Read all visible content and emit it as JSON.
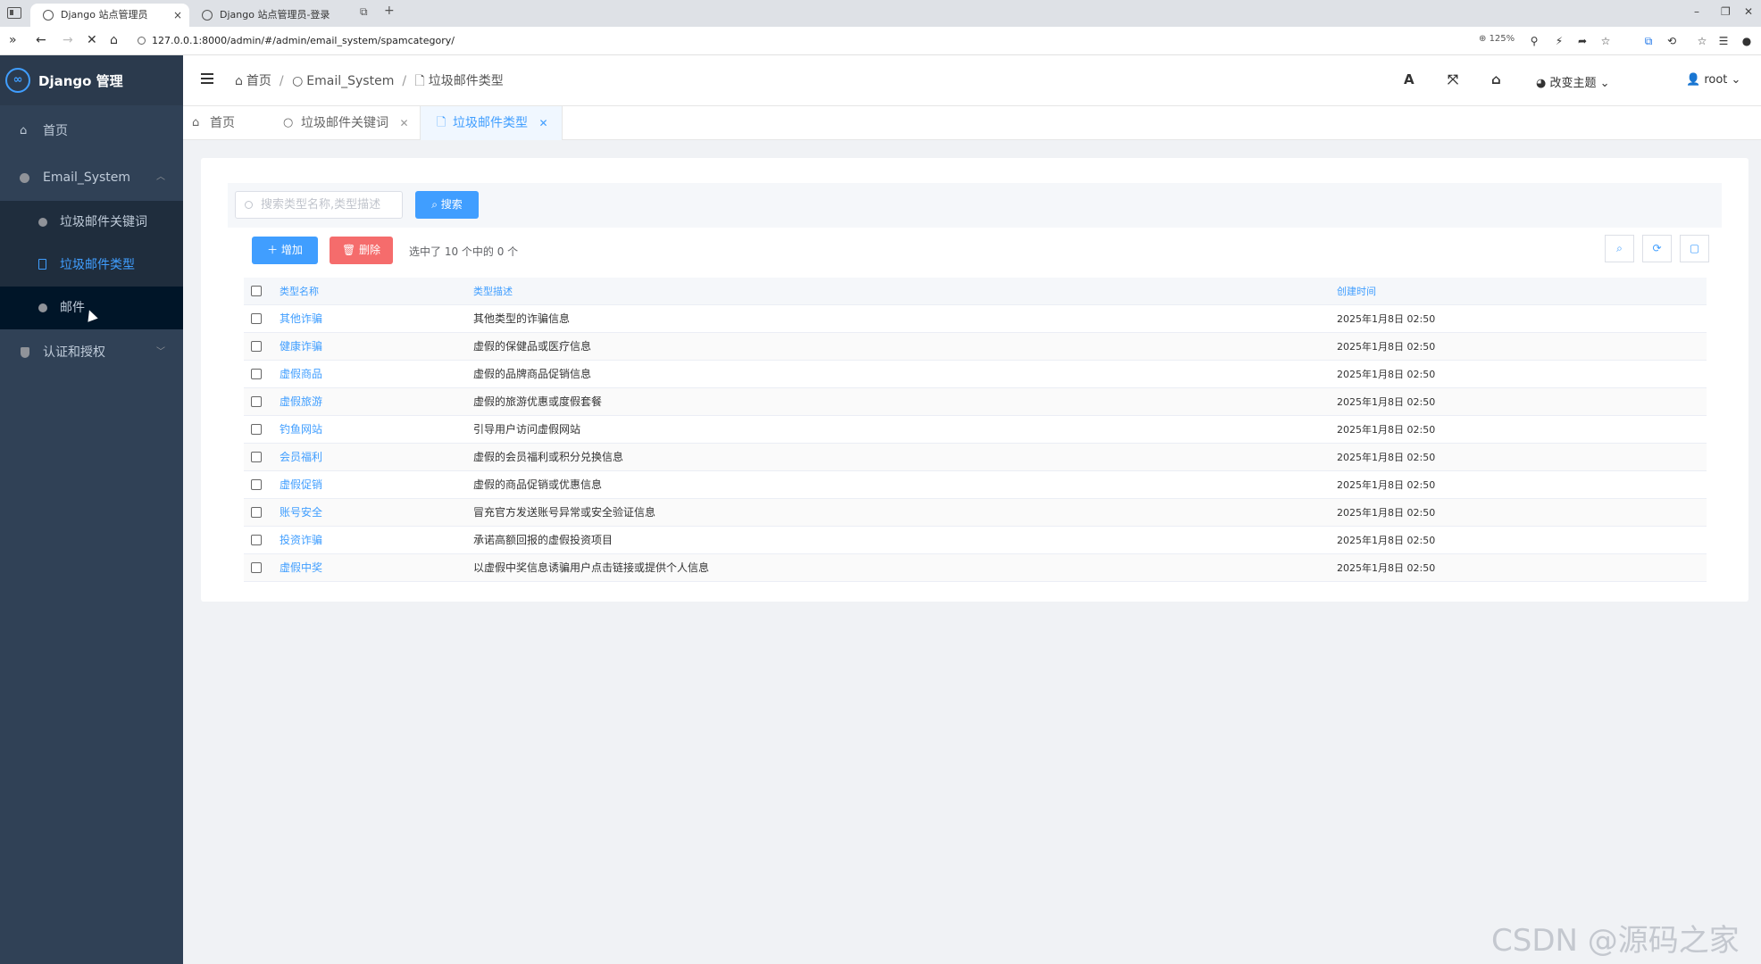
{
  "browser": {
    "tabs": [
      {
        "title": "Django 站点管理员",
        "active": true
      },
      {
        "title": "Django 站点管理员-登录",
        "active": false
      }
    ],
    "url": "127.0.0.1:8000/admin/#/admin/email_system/spamcategory/",
    "zoom": "125%"
  },
  "sidebar": {
    "logo_text": "Django 管理",
    "items": [
      {
        "label": "首页",
        "icon": "home-icon"
      },
      {
        "label": "Email_System",
        "icon": "circle-icon",
        "expanded": true,
        "children": [
          {
            "label": "垃圾邮件关键词",
            "icon": "circle-icon"
          },
          {
            "label": "垃圾邮件类型",
            "icon": "file-icon",
            "active": true
          },
          {
            "label": "邮件",
            "icon": "circle-icon"
          }
        ]
      },
      {
        "label": "认证和授权",
        "icon": "shield-icon",
        "expanded": false
      }
    ]
  },
  "header": {
    "breadcrumb": [
      "首页",
      "Email_System",
      "垃圾邮件类型"
    ],
    "theme_label": "改变主题",
    "user_label": "root"
  },
  "page_tabs": [
    {
      "label": "首页",
      "icon": "home-icon",
      "closable": false
    },
    {
      "label": "垃圾邮件关键词",
      "icon": "circle-icon",
      "closable": true
    },
    {
      "label": "垃圾邮件类型",
      "icon": "file-icon",
      "closable": true,
      "active": true
    }
  ],
  "toolbar": {
    "search_placeholder": "搜索类型名称,类型描述",
    "search_label": "搜索",
    "add_label": "增加",
    "delete_label": "删除",
    "selection_text": "选中了 10 个中的 0 个"
  },
  "table": {
    "headers": [
      "类型名称",
      "类型描述",
      "创建时间"
    ],
    "rows": [
      {
        "name": "其他诈骗",
        "desc": "其他类型的诈骗信息",
        "created": "2025年1月8日 02:50"
      },
      {
        "name": "健康诈骗",
        "desc": "虚假的保健品或医疗信息",
        "created": "2025年1月8日 02:50"
      },
      {
        "name": "虚假商品",
        "desc": "虚假的品牌商品促销信息",
        "created": "2025年1月8日 02:50"
      },
      {
        "name": "虚假旅游",
        "desc": "虚假的旅游优惠或度假套餐",
        "created": "2025年1月8日 02:50"
      },
      {
        "name": "钓鱼网站",
        "desc": "引导用户访问虚假网站",
        "created": "2025年1月8日 02:50"
      },
      {
        "name": "会员福利",
        "desc": "虚假的会员福利或积分兑换信息",
        "created": "2025年1月8日 02:50"
      },
      {
        "name": "虚假促销",
        "desc": "虚假的商品促销或优惠信息",
        "created": "2025年1月8日 02:50"
      },
      {
        "name": "账号安全",
        "desc": "冒充官方发送账号异常或安全验证信息",
        "created": "2025年1月8日 02:50"
      },
      {
        "name": "投资诈骗",
        "desc": "承诺高额回报的虚假投资项目",
        "created": "2025年1月8日 02:50"
      },
      {
        "name": "虚假中奖",
        "desc": "以虚假中奖信息诱骗用户点击链接或提供个人信息",
        "created": "2025年1月8日 02:50"
      }
    ]
  },
  "watermark": "CSDN @源码之家",
  "colors": {
    "primary": "#409eff",
    "danger": "#f56c6c",
    "sidebar_bg": "#304156"
  }
}
